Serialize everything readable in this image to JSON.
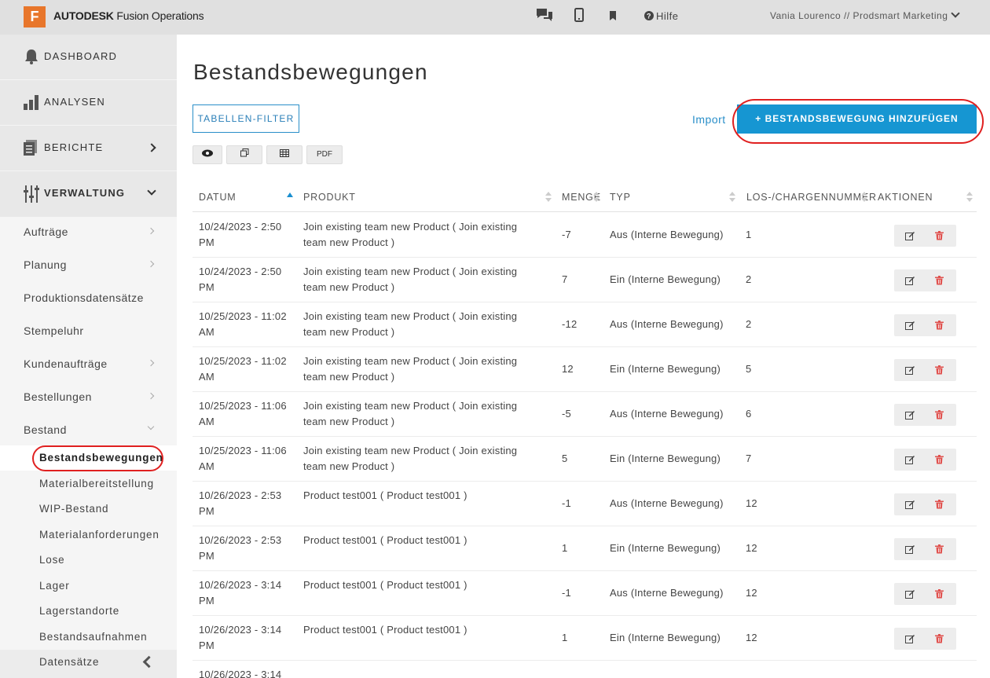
{
  "topbar": {
    "logo_letter": "F",
    "brand_bold": "AUTODESK",
    "brand_rest": " Fusion Operations",
    "help": "Hilfe",
    "user": "Vania Lourenco // Prodsmart Marketing"
  },
  "sidebar": {
    "main_items": [
      {
        "label": "DASHBOARD",
        "icon": "bell-icon"
      },
      {
        "label": "ANALYSEN",
        "icon": "bar-chart-icon"
      },
      {
        "label": "BERICHTE",
        "icon": "document-icon"
      },
      {
        "label": "VERWALTUNG",
        "icon": "sliders-icon"
      }
    ],
    "sub_items": [
      {
        "label": "Aufträge"
      },
      {
        "label": "Planung"
      },
      {
        "label": "Produktionsdatensätze"
      },
      {
        "label": "Stempeluhr"
      },
      {
        "label": "Kundenaufträge"
      },
      {
        "label": "Bestellungen"
      },
      {
        "label": "Bestand"
      }
    ],
    "stock_items": [
      {
        "label": "Bestandsbewegungen"
      },
      {
        "label": "Materialbereitstellung"
      },
      {
        "label": "WIP-Bestand"
      },
      {
        "label": "Materialanforderungen"
      },
      {
        "label": "Lose"
      },
      {
        "label": "Lager"
      },
      {
        "label": "Lagerstandorte"
      },
      {
        "label": "Bestandsaufnahmen"
      },
      {
        "label": "Datensätze"
      }
    ]
  },
  "main": {
    "title": "Bestandsbewegungen",
    "filter_button": "TABELLEN-FILTER",
    "import_link": "Import",
    "add_button": "+ BESTANDSBEWEGUNG HINZUFÜGEN",
    "toolbar": {
      "pdf": "PDF"
    },
    "columns": {
      "date": "DATUM",
      "product": "PRODUKT",
      "qty": "MENGE",
      "type": "TYP",
      "lot": "LOS-/CHARGENNUMMER",
      "actions": "AKTIONEN"
    },
    "rows": [
      {
        "date": "10/24/2023 - 2:50 PM",
        "product": "Join existing team new Product ( Join existing team new Product )",
        "qty": "-7",
        "type": "Aus (Interne Bewegung)",
        "lot": "1"
      },
      {
        "date": "10/24/2023 - 2:50 PM",
        "product": "Join existing team new Product ( Join existing team new Product )",
        "qty": "7",
        "type": "Ein (Interne Bewegung)",
        "lot": "2"
      },
      {
        "date": "10/25/2023 - 11:02 AM",
        "product": "Join existing team new Product ( Join existing team new Product )",
        "qty": "-12",
        "type": "Aus (Interne Bewegung)",
        "lot": "2"
      },
      {
        "date": "10/25/2023 - 11:02 AM",
        "product": "Join existing team new Product ( Join existing team new Product )",
        "qty": "12",
        "type": "Ein (Interne Bewegung)",
        "lot": "5"
      },
      {
        "date": "10/25/2023 - 11:06 AM",
        "product": "Join existing team new Product ( Join existing team new Product )",
        "qty": "-5",
        "type": "Aus (Interne Bewegung)",
        "lot": "6"
      },
      {
        "date": "10/25/2023 - 11:06 AM",
        "product": "Join existing team new Product ( Join existing team new Product )",
        "qty": "5",
        "type": "Ein (Interne Bewegung)",
        "lot": "7"
      },
      {
        "date": "10/26/2023 - 2:53 PM",
        "product": "Product test001 ( Product test001 )",
        "qty": "-1",
        "type": "Aus (Interne Bewegung)",
        "lot": "12"
      },
      {
        "date": "10/26/2023 - 2:53 PM",
        "product": "Product test001 ( Product test001 )",
        "qty": "1",
        "type": "Ein (Interne Bewegung)",
        "lot": "12"
      },
      {
        "date": "10/26/2023 - 3:14 PM",
        "product": "Product test001 ( Product test001 )",
        "qty": "-1",
        "type": "Aus (Interne Bewegung)",
        "lot": "12"
      },
      {
        "date": "10/26/2023 - 3:14 PM",
        "product": "Product test001 ( Product test001 )",
        "qty": "1",
        "type": "Ein (Interne Bewegung)",
        "lot": "12"
      },
      {
        "date": "10/26/2023 - 3:14",
        "product": "",
        "qty": "",
        "type": "",
        "lot": ""
      }
    ]
  },
  "colors": {
    "accent": "#1696d2",
    "highlight_ring": "#e02020",
    "brand": "#e8762b"
  }
}
